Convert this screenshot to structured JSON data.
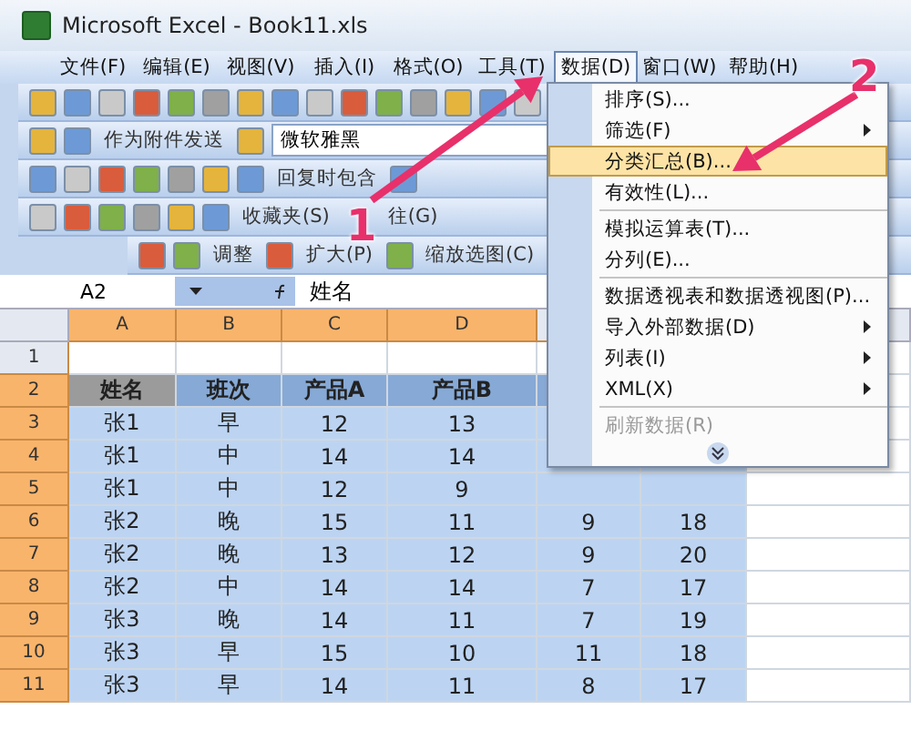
{
  "window": {
    "title": "Microsoft Excel - Book11.xls"
  },
  "menu_bar": [
    {
      "label": "文件(F)",
      "selected": false
    },
    {
      "label": "编辑(E)",
      "selected": false
    },
    {
      "label": "视图(V)",
      "selected": false
    },
    {
      "label": "插入(I)",
      "selected": false
    },
    {
      "label": "格式(O)",
      "selected": false
    },
    {
      "label": "工具(T)",
      "selected": false
    },
    {
      "label": "数据(D)",
      "selected": true
    },
    {
      "label": "窗口(W)",
      "selected": false
    },
    {
      "label": "帮助(H)",
      "selected": false
    }
  ],
  "toolbars": [
    {
      "items": [
        {
          "kind": "button",
          "label": "作为附件发送"
        },
        {
          "kind": "field",
          "label": "微软雅黑"
        }
      ]
    },
    {
      "items": [
        {
          "kind": "button",
          "label": "回复时包含"
        }
      ]
    },
    {
      "items": [
        {
          "kind": "button",
          "label": "收藏夹(S)"
        },
        {
          "kind": "button",
          "label": "往(G)"
        }
      ]
    },
    {
      "items": [
        {
          "kind": "button",
          "label": "调整"
        },
        {
          "kind": "button",
          "label": "扩大(P)"
        },
        {
          "kind": "button",
          "label": "缩放选图(C)"
        }
      ]
    }
  ],
  "formula_bar": {
    "name_box": "A2",
    "formula": "姓名"
  },
  "sheet": {
    "columns": [
      {
        "label": "A",
        "selected": true
      },
      {
        "label": "B",
        "selected": true
      },
      {
        "label": "C",
        "selected": true
      },
      {
        "label": "D",
        "selected": true
      }
    ],
    "rows": [
      {
        "number": "1",
        "selected": false,
        "cells": [
          "",
          "",
          "",
          "",
          "",
          ""
        ]
      },
      {
        "number": "2",
        "selected": true,
        "cells": [
          "姓名",
          "班次",
          "产品A",
          "产品B",
          "",
          ""
        ]
      },
      {
        "number": "3",
        "selected": true,
        "cells": [
          "张1",
          "早",
          "12",
          "13",
          "",
          ""
        ]
      },
      {
        "number": "4",
        "selected": true,
        "cells": [
          "张1",
          "中",
          "14",
          "14",
          "",
          ""
        ]
      },
      {
        "number": "5",
        "selected": true,
        "cells": [
          "张1",
          "中",
          "12",
          "9",
          "",
          ""
        ]
      },
      {
        "number": "6",
        "selected": true,
        "cells": [
          "张2",
          "晚",
          "15",
          "11",
          "9",
          "18"
        ]
      },
      {
        "number": "7",
        "selected": true,
        "cells": [
          "张2",
          "晚",
          "13",
          "12",
          "9",
          "20"
        ]
      },
      {
        "number": "8",
        "selected": true,
        "cells": [
          "张2",
          "中",
          "14",
          "14",
          "7",
          "17"
        ]
      },
      {
        "number": "9",
        "selected": true,
        "cells": [
          "张3",
          "晚",
          "14",
          "11",
          "7",
          "19"
        ]
      },
      {
        "number": "10",
        "selected": true,
        "cells": [
          "张3",
          "早",
          "15",
          "10",
          "11",
          "18"
        ]
      },
      {
        "number": "11",
        "selected": true,
        "cells": [
          "张3",
          "早",
          "14",
          "11",
          "8",
          "17"
        ]
      }
    ]
  },
  "data_menu": [
    {
      "kind": "item",
      "label": "排序(S)...",
      "selected": false,
      "submenu": false,
      "disabled": false
    },
    {
      "kind": "item",
      "label": "筛选(F)",
      "selected": false,
      "submenu": true,
      "disabled": false
    },
    {
      "kind": "item",
      "label": "分类汇总(B)...",
      "selected": true,
      "submenu": false,
      "disabled": false
    },
    {
      "kind": "item",
      "label": "有效性(L)...",
      "selected": false,
      "submenu": false,
      "disabled": false
    },
    {
      "kind": "separator"
    },
    {
      "kind": "item",
      "label": "模拟运算表(T)...",
      "selected": false,
      "submenu": false,
      "disabled": false
    },
    {
      "kind": "item",
      "label": "分列(E)...",
      "selected": false,
      "submenu": false,
      "disabled": false
    },
    {
      "kind": "separator"
    },
    {
      "kind": "item",
      "label": "数据透视表和数据透视图(P)...",
      "selected": false,
      "submenu": false,
      "disabled": false
    },
    {
      "kind": "item",
      "label": "导入外部数据(D)",
      "selected": false,
      "submenu": true,
      "disabled": false
    },
    {
      "kind": "item",
      "label": "列表(I)",
      "selected": false,
      "submenu": true,
      "disabled": false
    },
    {
      "kind": "item",
      "label": "XML(X)",
      "selected": false,
      "submenu": true,
      "disabled": false
    },
    {
      "kind": "separator"
    },
    {
      "kind": "item",
      "label": "刷新数据(R)",
      "selected": false,
      "submenu": false,
      "disabled": true
    },
    {
      "kind": "expand"
    }
  ],
  "annotations": [
    {
      "label": "1"
    },
    {
      "label": "2"
    }
  ]
}
